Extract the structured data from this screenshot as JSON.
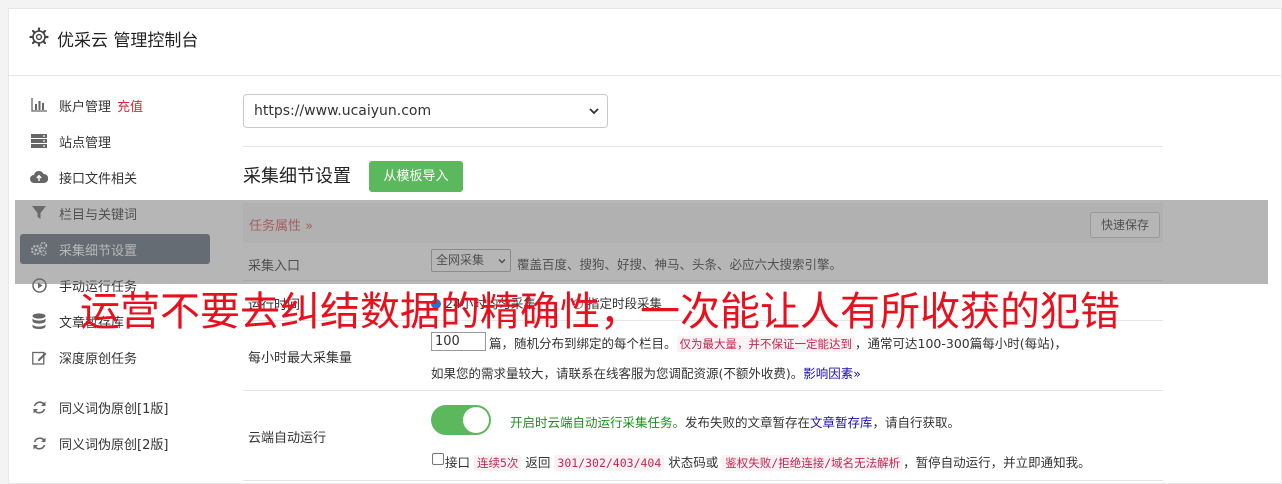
{
  "header": {
    "title": "优采云 管理控制台"
  },
  "sidebar": {
    "items": [
      {
        "label": "账户管理",
        "extra": "充值",
        "icon": "bar-chart-icon"
      },
      {
        "label": "站点管理",
        "icon": "server-icon"
      },
      {
        "label": "接口文件相关",
        "icon": "cloud-upload-icon"
      },
      {
        "label": "栏目与关键词",
        "icon": "filter-icon"
      },
      {
        "label": "采集细节设置",
        "icon": "gears-icon",
        "active": true
      },
      {
        "label": "手动运行任务",
        "icon": "play-circle-icon"
      },
      {
        "label": "文章暂存库",
        "icon": "database-icon"
      },
      {
        "label": "深度原创任务",
        "icon": "edit-icon"
      },
      {
        "label": "同义词伪原创[1版]",
        "icon": "refresh-icon"
      },
      {
        "label": "同义词伪原创[2版]",
        "icon": "refresh-icon"
      }
    ]
  },
  "main": {
    "site_select": "https://www.ucaiyun.com",
    "section_title": "采集细节设置",
    "import_button": "从模板导入",
    "tab_label": "任务属性 »",
    "save_button": "快速保存",
    "entry": {
      "label": "采集入口",
      "select_value": "全网采集",
      "desc": "覆盖百度、搜狗、好搜、神马、头条、必应六大搜索引擎。"
    },
    "runtime": {
      "label": "运行时间",
      "opt1": "24小时均匀采集",
      "opt2": "指定时段采集"
    },
    "max_per_hour": {
      "label": "每小时最大采集量",
      "value": "100",
      "text1": "篇，随机分布到绑定的每个栏目。",
      "code1": "仅为最大量，并不保证一定能达到",
      "text2": "，通常可达100-300篇每小时(每站)，",
      "line2": "如果您的需求量较大，请联系在线客服为您调配资源(不额外收费)。",
      "link": "影响因素»"
    },
    "cloud_run": {
      "label": "云端自动运行",
      "green": "开启时云端自动运行采集任务。",
      "text1": "发布失败的文章暂存在",
      "link": "文章暂存库",
      "text2": "，请自行获取。",
      "cb_text1": "接口",
      "code1": "连续5次",
      "cb_text2": "返回",
      "code2": "301/302/403/404",
      "cb_text3": "状态码或",
      "code3": "鉴权失败/拒绝连接/域名无法解析",
      "cb_text4": "，暂停自动运行，并立即通知我。"
    }
  },
  "overlay_text": "运营不要去纠结数据的精确性，一次能让人有所收获的犯错",
  "colors": {
    "accent_green": "#5cb85c",
    "overlay_red": "#e8101c",
    "active_bg": "#5f6a78"
  }
}
